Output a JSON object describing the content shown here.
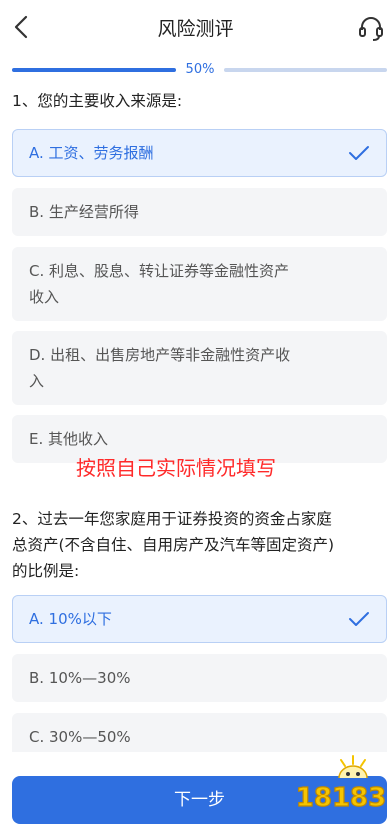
{
  "header": {
    "title": "风险测评",
    "back_icon": "chevron-left-icon",
    "service_icon": "headset-icon"
  },
  "progress": {
    "label": "50%",
    "value": 0.5
  },
  "questions": [
    {
      "text_lines": [
        "1、您的主要收入来源是:"
      ],
      "options": [
        {
          "lines": [
            "A. 工资、劳务报酬"
          ],
          "selected": true
        },
        {
          "lines": [
            "B. 生产经营所得"
          ],
          "selected": false
        },
        {
          "lines": [
            "C. 利息、股息、转让证券等金融性资产",
            "收入"
          ],
          "selected": false
        },
        {
          "lines": [
            "D. 出租、出售房地产等非金融性资产收",
            "入"
          ],
          "selected": false
        },
        {
          "lines": [
            "E. 其他收入"
          ],
          "selected": false
        }
      ]
    },
    {
      "text_lines": [
        "2、过去一年您家庭用于证券投资的资金占家庭",
        "总资产(不含自住、自用房产及汽车等固定资产)",
        "的比例是:"
      ],
      "options": [
        {
          "lines": [
            "A. 10%以下"
          ],
          "selected": true
        },
        {
          "lines": [
            "B. 10%—30%"
          ],
          "selected": false
        },
        {
          "lines": [
            "C. 30%—50%"
          ],
          "selected": false
        }
      ]
    }
  ],
  "overlay_note": "按照自己实际情况填写",
  "next_button": "下一步",
  "watermark": {
    "text": "18183",
    "brand_color": "#f5c400"
  },
  "colors": {
    "accent": "#2f6fe0",
    "selected_bg": "#eaf2fe",
    "option_bg": "#f4f5f7",
    "note": "#ff2a2a"
  }
}
